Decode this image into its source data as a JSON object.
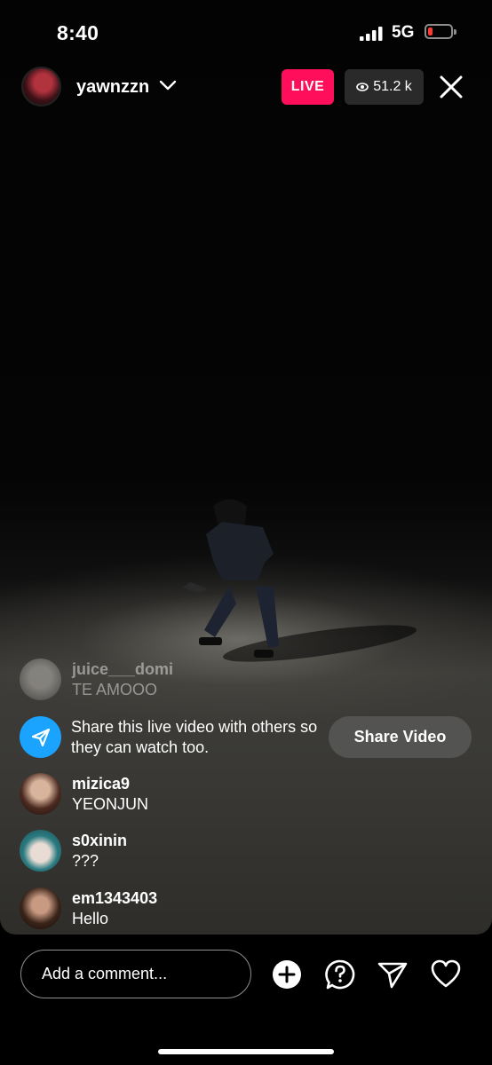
{
  "status": {
    "time": "8:40",
    "network": "5G"
  },
  "host": {
    "username": "yawnzzn",
    "live_label": "LIVE",
    "viewer_count": "51.2 k"
  },
  "comments": [
    {
      "user": "juice___domi",
      "text": "TE AMOOO"
    },
    {
      "user": "mizica9",
      "text": "YEONJUN"
    },
    {
      "user": "s0xinin",
      "text": "???"
    },
    {
      "user": "em1343403",
      "text": "Hello"
    }
  ],
  "share_prompt": {
    "text": "Share this live video with others so they can watch too.",
    "button": "Share Video"
  },
  "comment_box": {
    "placeholder": "Add a comment..."
  },
  "icons": [
    "signal-icon",
    "battery-icon",
    "chevron-down-icon",
    "eye-icon",
    "close-icon",
    "send-icon",
    "add-icon",
    "question-icon",
    "paper-plane-icon",
    "heart-icon"
  ],
  "colors": {
    "live": "#ff0f5b",
    "share_icon": "#1aa3ff"
  }
}
